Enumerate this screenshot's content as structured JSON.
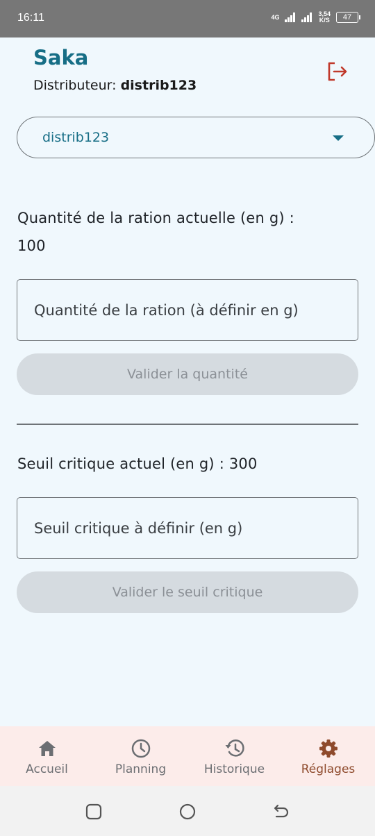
{
  "status_bar": {
    "time": "16:11",
    "network_4g": "4G",
    "speed_value": "3,54",
    "speed_unit": "K/S",
    "battery": "47"
  },
  "header": {
    "app_title": "Saka",
    "distributor_label": "Distributeur:",
    "distributor_id": "distrib123"
  },
  "selector": {
    "selected": "distrib123"
  },
  "ration": {
    "label": "Quantité de la ration actuelle (en g) :",
    "current_value": "100",
    "input_placeholder": "Quantité de la ration (à définir en g)",
    "button_label": "Valider la quantité"
  },
  "seuil": {
    "label": "Seuil critique actuel (en g) : 300",
    "input_placeholder": "Seuil critique à définir (en g)",
    "button_label": "Valider le seuil critique"
  },
  "bottom_nav": {
    "items": [
      {
        "label": "Accueil",
        "icon": "home-icon"
      },
      {
        "label": "Planning",
        "icon": "clock-icon"
      },
      {
        "label": "Historique",
        "icon": "history-icon"
      },
      {
        "label": "Réglages",
        "icon": "gear-icon",
        "active": true
      }
    ]
  },
  "colors": {
    "accent": "#176e86",
    "logout": "#c0392b",
    "nav_active": "#8e4a2c",
    "nav_bg": "#fcecea",
    "page_bg": "#f0f8fd"
  }
}
